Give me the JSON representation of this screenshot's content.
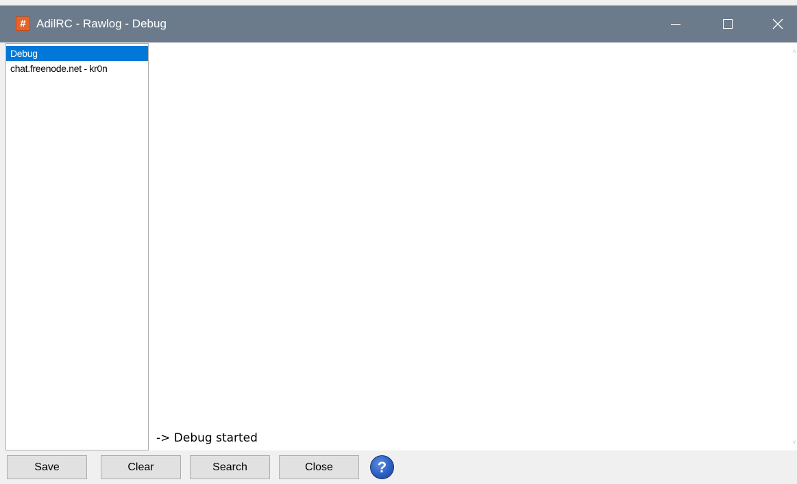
{
  "window": {
    "title": "AdilRC - Rawlog - Debug",
    "app_icon_glyph": "#",
    "app_icon_color": "#e8632b",
    "titlebar_color": "#6b7b8c",
    "controls": {
      "minimize_icon": "minimize-icon",
      "maximize_icon": "maximize-icon",
      "close_icon": "close-icon",
      "close_glyph": "✕"
    }
  },
  "sidebar": {
    "items": [
      {
        "label": "Debug",
        "selected": true
      },
      {
        "label": "chat.freenode.net - kr0n",
        "selected": false
      }
    ],
    "selected_color": "#0078d7"
  },
  "log": {
    "lines": [
      "-> Debug started"
    ]
  },
  "scrollbar": {
    "up_glyph": "˄",
    "down_glyph": "˅"
  },
  "buttons": {
    "save": "Save",
    "clear": "Clear",
    "search": "Search",
    "close": "Close",
    "help_glyph": "?",
    "help_icon": "help-icon"
  }
}
